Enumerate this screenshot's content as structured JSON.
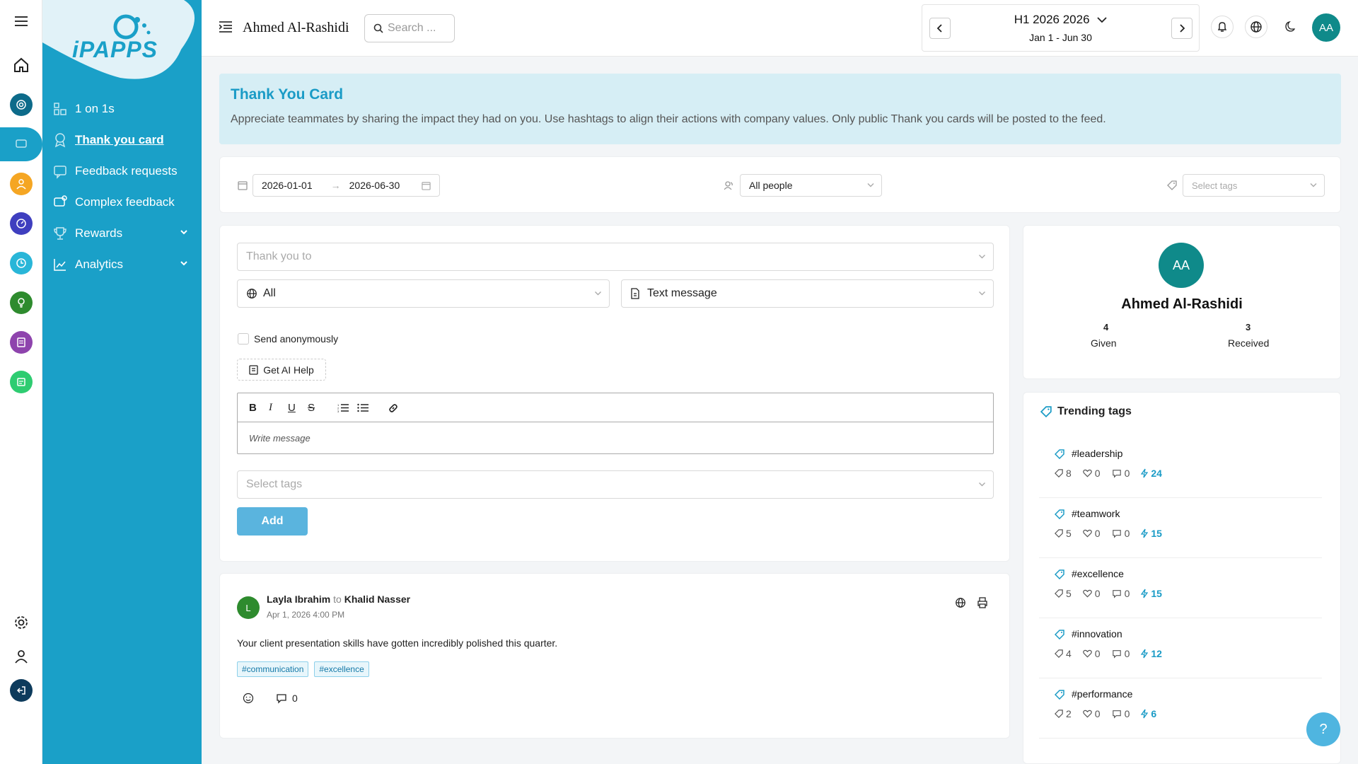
{
  "app": {
    "brand": "iPAPPS",
    "user_name": "Ahmed Al-Rashidi",
    "user_initials": "AA"
  },
  "search": {
    "placeholder": "Search ..."
  },
  "period": {
    "title": "H1 2026 2026",
    "range": "Jan 1 - Jun 30"
  },
  "sidebar": {
    "items": [
      {
        "label": "1 on 1s",
        "icon": "people-icon"
      },
      {
        "label": "Thank you card",
        "icon": "award-icon",
        "active": true
      },
      {
        "label": "Feedback requests",
        "icon": "feedback-icon"
      },
      {
        "label": "Complex feedback",
        "icon": "chat-icon"
      },
      {
        "label": "Rewards",
        "icon": "trophy-icon"
      },
      {
        "label": "Analytics",
        "icon": "chart-icon"
      }
    ]
  },
  "rail_colors": [
    "#0d6b8a",
    "#1aa0c8",
    "#f5a623",
    "#3f3fbf",
    "#29b6d8",
    "#2e8b2e",
    "#8e44ad",
    "#2ecc71"
  ],
  "banner": {
    "title": "Thank You Card",
    "description": "Appreciate teammates by sharing the impact they had on you. Use hashtags to align their actions with company values. Only public Thank you cards will be posted to the feed."
  },
  "filters": {
    "date_from": "2026-01-01",
    "date_to": "2026-06-30",
    "people": "All people",
    "tags_placeholder": "Select tags"
  },
  "form": {
    "recipient_placeholder": "Thank you to",
    "visibility": "All",
    "message_type": "Text message",
    "anonymous_label": "Send anonymously",
    "ai_help_label": "Get AI Help",
    "message_placeholder": "Write message",
    "tags_placeholder": "Select tags",
    "add_label": "Add"
  },
  "post": {
    "author": "Layla Ibrahim",
    "author_initial": "L",
    "to_word": "to",
    "recipient": "Khalid Nasser",
    "time": "Apr 1, 2026 4:00 PM",
    "message": "Your client presentation skills have gotten incredibly polished this quarter.",
    "tags": [
      "#communication",
      "#excellence"
    ],
    "comment_count": "0"
  },
  "profile": {
    "initials": "AA",
    "name": "Ahmed Al-Rashidi",
    "given_count": "4",
    "given_label": "Given",
    "received_count": "3",
    "received_label": "Received"
  },
  "trending": {
    "title": "Trending tags",
    "items": [
      {
        "name": "#leadership",
        "tags": "8",
        "likes": "0",
        "comments": "0",
        "boost": "24"
      },
      {
        "name": "#teamwork",
        "tags": "5",
        "likes": "0",
        "comments": "0",
        "boost": "15"
      },
      {
        "name": "#excellence",
        "tags": "5",
        "likes": "0",
        "comments": "0",
        "boost": "15"
      },
      {
        "name": "#innovation",
        "tags": "4",
        "likes": "0",
        "comments": "0",
        "boost": "12"
      },
      {
        "name": "#performance",
        "tags": "2",
        "likes": "0",
        "comments": "0",
        "boost": "6"
      }
    ]
  },
  "help": {
    "label": "?"
  }
}
